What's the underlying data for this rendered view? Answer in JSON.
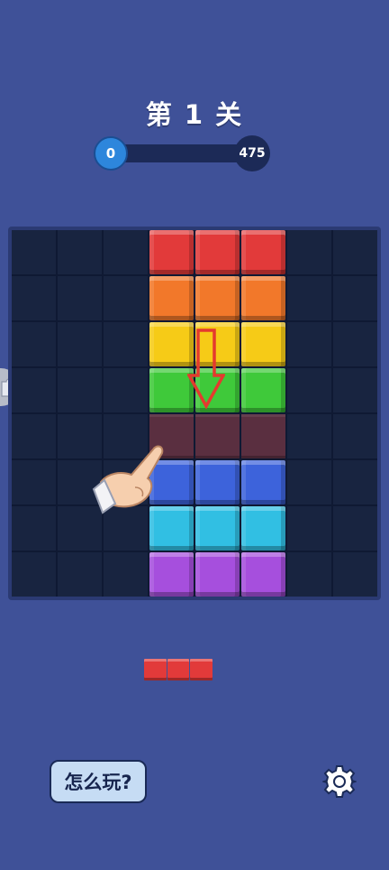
{
  "level": {
    "title": "第 1 关"
  },
  "progress": {
    "current": "0",
    "target": "475",
    "fraction": 0
  },
  "board": {
    "rows": 8,
    "cols": 8,
    "cells": [
      [
        "",
        "",
        "",
        "#e23a3a",
        "#e23a3a",
        "#e23a3a",
        "",
        ""
      ],
      [
        "",
        "",
        "",
        "#f2782a",
        "#f2782a",
        "#f2782a",
        "",
        ""
      ],
      [
        "",
        "",
        "",
        "#f6cb17",
        "#f6cb17",
        "#f6cb17",
        "",
        ""
      ],
      [
        "",
        "",
        "",
        "#3fc93a",
        "#3fc93a",
        "#3fc93a",
        "",
        ""
      ],
      [
        "",
        "",
        "",
        "ghost",
        "ghost",
        "ghost",
        "",
        ""
      ],
      [
        "",
        "",
        "",
        "#3d63db",
        "#3d63db",
        "#3d63db",
        "",
        ""
      ],
      [
        "",
        "",
        "",
        "#31bfe3",
        "#31bfe3",
        "#31bfe3",
        "",
        ""
      ],
      [
        "",
        "",
        "",
        "#a64fdd",
        "#a64fdd",
        "#a64fdd",
        "",
        ""
      ]
    ],
    "ghost_color": "#5a2f40"
  },
  "hint": {
    "arrow_icon": "arrow-down-icon",
    "hand_icon": "pointing-hand-icon",
    "arrow_color": "#e43a2e"
  },
  "next_piece": {
    "color": "#e23a3a",
    "blocks": 3
  },
  "footer": {
    "howto_label": "怎么玩?",
    "settings_icon": "gear-icon"
  }
}
